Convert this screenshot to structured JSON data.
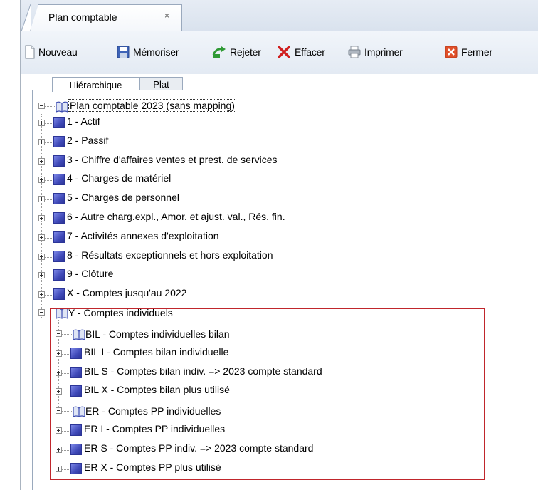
{
  "tab": {
    "title": "Plan comptable",
    "close_glyph": "×"
  },
  "toolbar": {
    "nouveau": "Nouveau",
    "memoriser": "Mémoriser",
    "rejeter": "Rejeter",
    "effacer": "Effacer",
    "imprimer": "Imprimer",
    "fermer": "Fermer"
  },
  "view_tabs": {
    "hierarchique": "Hiérarchique",
    "plat": "Plat"
  },
  "tree": {
    "root": "Plan comptable 2023 (sans mapping)",
    "items": [
      "1 - Actif",
      "2 - Passif",
      "3 - Chiffre d'affaires ventes et prest. de services",
      "4 - Charges de matériel",
      "5 - Charges de personnel",
      "6 - Autre charg.expl., Amor. et ajust. val., Rés. fin.",
      "7 - Activités annexes d'exploitation",
      "8 - Résultats exceptionnels et hors exploitation",
      "9 - Clôture",
      "X - Comptes jusqu'au 2022"
    ],
    "y_group": "Y - Comptes individuels",
    "bil_group": "BIL - Comptes individuelles bilan",
    "bil_items": [
      "BIL I - Comptes bilan individuelle",
      "BIL S - Comptes bilan indiv. => 2023 compte standard",
      "BIL X - Comptes bilan plus utilisé"
    ],
    "er_group": "ER - Comptes PP individuelles",
    "er_items": [
      "ER I - Comptes PP individuelles",
      "ER S - Comptes PP indiv. => 2023 compte standard",
      "ER X - Comptes PP plus utilisé"
    ]
  },
  "colors": {
    "highlight": "#c0262c",
    "account_icon": "#3f49b8"
  }
}
